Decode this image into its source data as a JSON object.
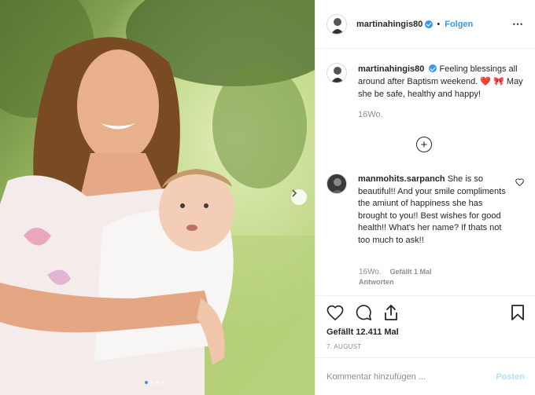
{
  "post": {
    "username": "martinahingis80",
    "follow_label": "Folgen",
    "more_icon": "⋯",
    "caption_text": "Feeling blessings all around after Baptism weekend. ❤️ 🎀 May she be safe, healthy and happy!",
    "caption_time": "16Wo.",
    "likes": "Gefällt 12.411 Mal",
    "date": "7. AUGUST"
  },
  "comment": {
    "username": "manmohits.sarpanch",
    "text": "She is so beautiful!! And your smile compliments the amiunt of happiness she has brought to you!! Best wishes for good health!! What's her name? If thats not too much to ask!!",
    "time": "16Wo.",
    "likes": "Gefällt 1 Mal",
    "reply_label": "Antworten"
  },
  "composer": {
    "placeholder": "Kommentar hinzufügen ...",
    "post_label": "Posten"
  },
  "carousel": {
    "current": 1,
    "total": 4
  },
  "colors": {
    "link": "#3897f0",
    "secondary": "#8e8e8e",
    "post_disabled": "#b2dffc",
    "heart_red": "#ed4956"
  },
  "icons": [
    "more-options-icon",
    "add-comment-plus-icon",
    "heart-icon",
    "comment-icon",
    "share-icon",
    "bookmark-icon",
    "next-arrow-icon",
    "verified-badge-icon"
  ]
}
